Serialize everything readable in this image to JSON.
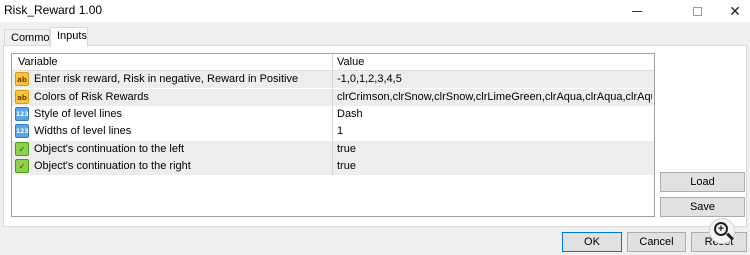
{
  "window": {
    "title": "Risk_Reward 1.00"
  },
  "tabs": [
    {
      "label": "Common"
    },
    {
      "label": "Inputs"
    }
  ],
  "table": {
    "headers": {
      "variable": "Variable",
      "value": "Value"
    },
    "rows": [
      {
        "icon": "text-param-icon",
        "variable": "Enter risk reward, Risk in negative, Reward in Positive",
        "value": "-1,0,1,2,3,4,5"
      },
      {
        "icon": "text-param-icon",
        "variable": "Colors of Risk Rewards",
        "value": "clrCrimson,clrSnow,clrSnow,clrLimeGreen,clrAqua,clrAqua,clrAqua"
      },
      {
        "icon": "numeric-param-icon",
        "variable": "Style of level lines",
        "value": "Dash"
      },
      {
        "icon": "numeric-param-icon",
        "variable": "Widths of level lines",
        "value": "1"
      },
      {
        "icon": "bool-param-icon",
        "variable": "Object's continuation to the left",
        "value": "true"
      },
      {
        "icon": "bool-param-icon",
        "variable": "Object's continuation to the right",
        "value": "true"
      }
    ]
  },
  "buttons": {
    "load": "Load",
    "save": "Save",
    "ok": "OK",
    "cancel": "Cancel",
    "reset": "Reset"
  },
  "icon_glyphs": {
    "text": "ab",
    "numeric": "123",
    "bool": "✓"
  }
}
